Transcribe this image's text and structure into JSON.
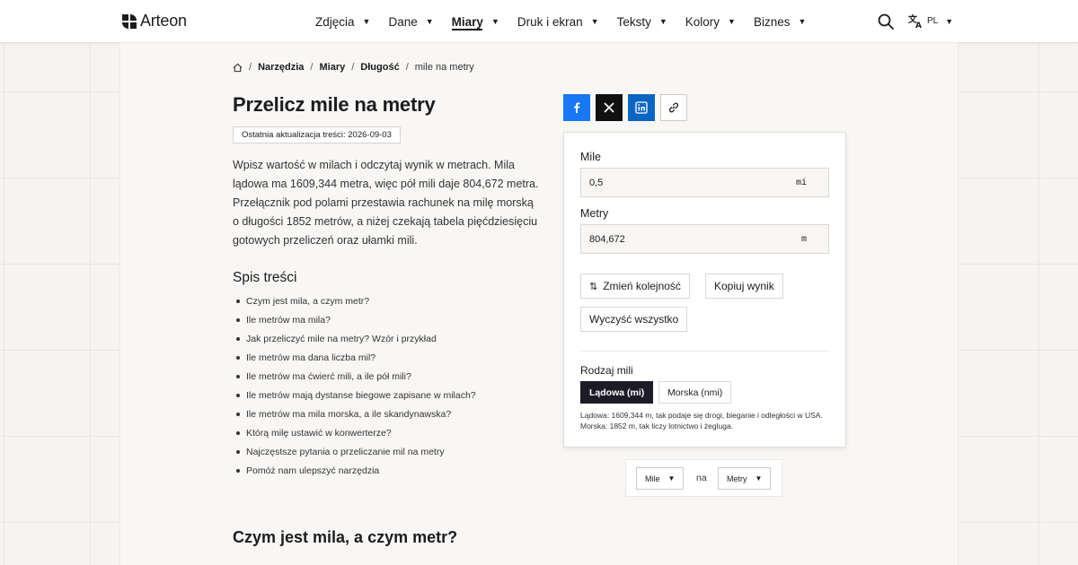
{
  "brand": {
    "name": "Arteon"
  },
  "nav": {
    "items": [
      {
        "label": "Zdjęcia",
        "active": false
      },
      {
        "label": "Dane",
        "active": false
      },
      {
        "label": "Miary",
        "active": true
      },
      {
        "label": "Druk i ekran",
        "active": false
      },
      {
        "label": "Teksty",
        "active": false
      },
      {
        "label": "Kolory",
        "active": false
      },
      {
        "label": "Biznes",
        "active": false
      }
    ],
    "search_icon": "search-icon",
    "language": {
      "icon": "translate-icon",
      "code": "PL"
    }
  },
  "breadcrumb": {
    "items": [
      "Narzędzia",
      "Miary",
      "Długość",
      "mile na metry"
    ]
  },
  "page": {
    "title": "Przelicz mile na metry",
    "updated": "Ostatnia aktualizacja treści: 2026-09-03",
    "intro": "Wpisz wartość w milach i odczytaj wynik w metrach. Mila lądowa ma 1609,344 metra, więc pół mili daje 804,672 metra. Przełącznik pod polami przestawia rachunek na milę morską o długości 1852 metrów, a niżej czekają tabela pięćdziesięciu gotowych przeliczeń oraz ułamki mili."
  },
  "toc": {
    "title": "Spis treści",
    "items": [
      "Czym jest mila, a czym metr?",
      "Ile metrów ma mila?",
      "Jak przeliczyć mile na metry? Wzór i przykład",
      "Ile metrów ma dana liczba mil?",
      "Ile metrów ma ćwierć mili, a ile pół mili?",
      "Ile metrów mają dystanse biegowe zapisane w milach?",
      "Ile metrów ma mila morska, a ile skandynawska?",
      "Którą milę ustawić w konwerterze?",
      "Najczęstsze pytania o przeliczanie mil na metry",
      "Pomóż nam ulepszyć narzędzia"
    ]
  },
  "section_heading": "Czym jest mila, a czym metr?",
  "share": {
    "buttons": [
      "facebook-icon",
      "x-icon",
      "linkedin-icon",
      "link-icon"
    ],
    "colors": {
      "facebook": "#1877f2",
      "x": "#111111",
      "linkedin": "#0a66c2"
    }
  },
  "converter": {
    "from": {
      "label": "Mile",
      "value": "0,5",
      "unit": "mi"
    },
    "to": {
      "label": "Metry",
      "value": "804,672",
      "unit": "m"
    },
    "swap_label": "Zmień kolejność",
    "copy_label": "Kopiuj wynik",
    "clear_label": "Wyczyść wszystko",
    "mile_type": {
      "label": "Rodzaj mili",
      "options": [
        "Lądowa (mi)",
        "Morska (nmi)"
      ],
      "selected": "Lądowa (mi)"
    },
    "note": "Lądowa: 1609,344 m, tak podaje się drogi, bieganie i odległości w USA. Morska: 1852 m, tak liczy lotnictwo i żegluga."
  },
  "unit_selector": {
    "from": "Mile",
    "connector": "na",
    "to": "Metry"
  }
}
